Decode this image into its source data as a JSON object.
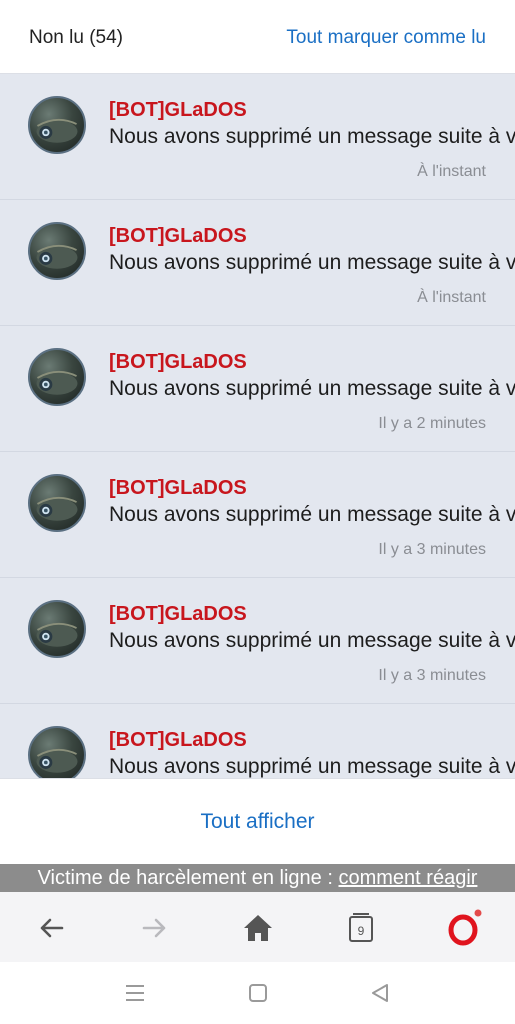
{
  "header": {
    "unread_label": "Non lu (54)",
    "mark_all_label": "Tout marquer comme lu"
  },
  "notifications": [
    {
      "author": "[BOT]GLaDOS",
      "message": "Nous avons supprimé un message suite à v",
      "time": "À l'instant"
    },
    {
      "author": "[BOT]GLaDOS",
      "message": "Nous avons supprimé un message suite à v",
      "time": "À l'instant"
    },
    {
      "author": "[BOT]GLaDOS",
      "message": "Nous avons supprimé un message suite à v",
      "time": "Il y a 2 minutes"
    },
    {
      "author": "[BOT]GLaDOS",
      "message": "Nous avons supprimé un message suite à v",
      "time": "Il y a 3 minutes"
    },
    {
      "author": "[BOT]GLaDOS",
      "message": "Nous avons supprimé un message suite à v",
      "time": "Il y a 3 minutes"
    },
    {
      "author": "[BOT]GLaDOS",
      "message": "Nous avons supprimé un message suite à v",
      "time": ""
    }
  ],
  "footer": {
    "show_all_label": "Tout afficher"
  },
  "banner": {
    "text": "Victime de harcèlement en ligne : ",
    "link": "comment réagir"
  },
  "browser_toolbar": {
    "tab_count": "9",
    "icons": [
      "back-arrow-icon",
      "forward-arrow-icon",
      "home-icon",
      "tabs-icon",
      "opera-logo-icon"
    ]
  },
  "system_nav": {
    "icons": [
      "menu-icon",
      "home-square-icon",
      "back-triangle-icon"
    ]
  },
  "colors": {
    "accent": "#1a6fc4",
    "author": "#c8161d",
    "unread_bg": "#e3e7ef",
    "banner_bg": "#8c8c8c",
    "opera_red": "#e0141e"
  }
}
